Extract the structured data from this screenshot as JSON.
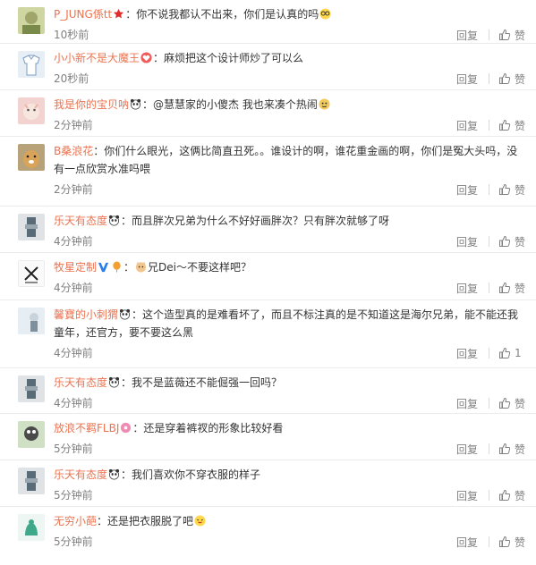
{
  "comments": [
    {
      "user": "P_JUNG係tt",
      "badge": "star",
      "text": "：你不说我都认不出来，你们是认真的吗",
      "emoji": "glasses",
      "time": "10秒前",
      "reply": "回复",
      "like": "赞"
    },
    {
      "user": "小小新不是大魔王",
      "badge": "heart",
      "text": "：麻烦把这个设计师炒了可以么",
      "emoji": "",
      "time": "20秒前",
      "reply": "回复",
      "like": "赞"
    },
    {
      "user": "我是你的宝贝呐",
      "badge": "panda",
      "text": "：@慧慧家的小傻杰 我也来凑个热闹",
      "emoji": "doge",
      "time": "2分钟前",
      "reply": "回复",
      "like": "赞"
    },
    {
      "user": "B桑浪花",
      "badge": "",
      "text": "：你们什么眼光，这俩比简直丑死。。谁设计的啊，谁花重金画的啊，你们是冤大头吗，没有一点欣赏水准吗喂",
      "emoji": "",
      "time": "2分钟前",
      "reply": "回复",
      "like": "赞"
    },
    {
      "user": "乐天有态度",
      "badge": "panda",
      "text": "：而且胖次兄弟为什么不好好画胖次？只有胖次就够了呀",
      "emoji": "",
      "time": "4分钟前",
      "reply": "回复",
      "like": "赞"
    },
    {
      "user": "牧星定制",
      "badge": "v-balloon",
      "text": "兄Dei～不要这样吧？",
      "emoji": "cat",
      "time": "4分钟前",
      "reply": "回复",
      "like": "赞"
    },
    {
      "user": "馨寶的小刺猬",
      "badge": "panda",
      "text": "：这个造型真的是难看坏了，而且不标注真的是不知道这是海尔兄弟，能不能还我童年，还官方，要不要这么黑",
      "emoji": "",
      "time": "4分钟前",
      "reply": "回复",
      "like": "1"
    },
    {
      "user": "乐天有态度",
      "badge": "panda",
      "text": "：我不是蓝薇还不能倔强一回吗？",
      "emoji": "",
      "time": "4分钟前",
      "reply": "回复",
      "like": "赞"
    },
    {
      "user": "放浪不羁FLBJ",
      "badge": "donut",
      "text": "：还是穿着裤衩的形象比较好看",
      "emoji": "",
      "time": "5分钟前",
      "reply": "回复",
      "like": "赞"
    },
    {
      "user": "乐天有态度",
      "badge": "panda",
      "text": "：我们喜欢你不穿衣服的样子",
      "emoji": "",
      "time": "5分钟前",
      "reply": "回复",
      "like": "赞"
    },
    {
      "user": "无穷小葩",
      "badge": "",
      "text": "：还是把衣服脱了吧",
      "emoji": "laugh",
      "time": "5分钟前",
      "reply": "回复",
      "like": "赞"
    }
  ],
  "colors": {
    "username": "#eb7350",
    "meta": "#808080",
    "text": "#333333",
    "divider": "#ececec"
  }
}
